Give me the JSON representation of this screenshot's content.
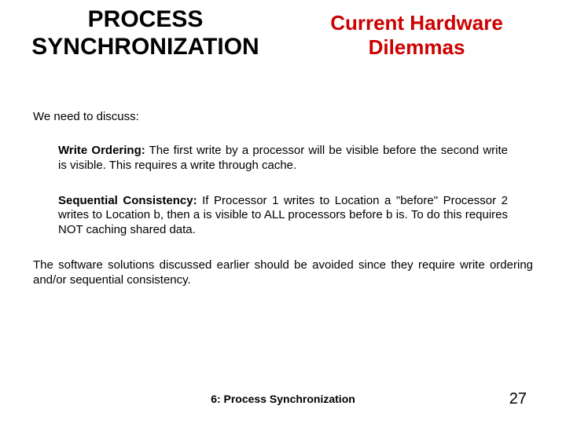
{
  "header": {
    "left_title": "PROCESS SYNCHRONIZATION",
    "right_title": "Current Hardware Dilemmas"
  },
  "body": {
    "lead": "We need to discuss:",
    "topics": [
      {
        "label": "Write Ordering:",
        "text": " The first write by a processor will be visible before the second write is visible. This requires a write through cache."
      },
      {
        "label": "Sequential Consistency:",
        "text": " If Processor 1 writes to Location a \"before\" Processor 2 writes to Location b, then a is visible to ALL processors before b is. To do this requires NOT caching shared data."
      }
    ],
    "conclusion": "The software solutions discussed earlier should be avoided since they require write ordering and/or sequential consistency."
  },
  "footer": {
    "center": "6: Process Synchronization",
    "page": "27"
  }
}
